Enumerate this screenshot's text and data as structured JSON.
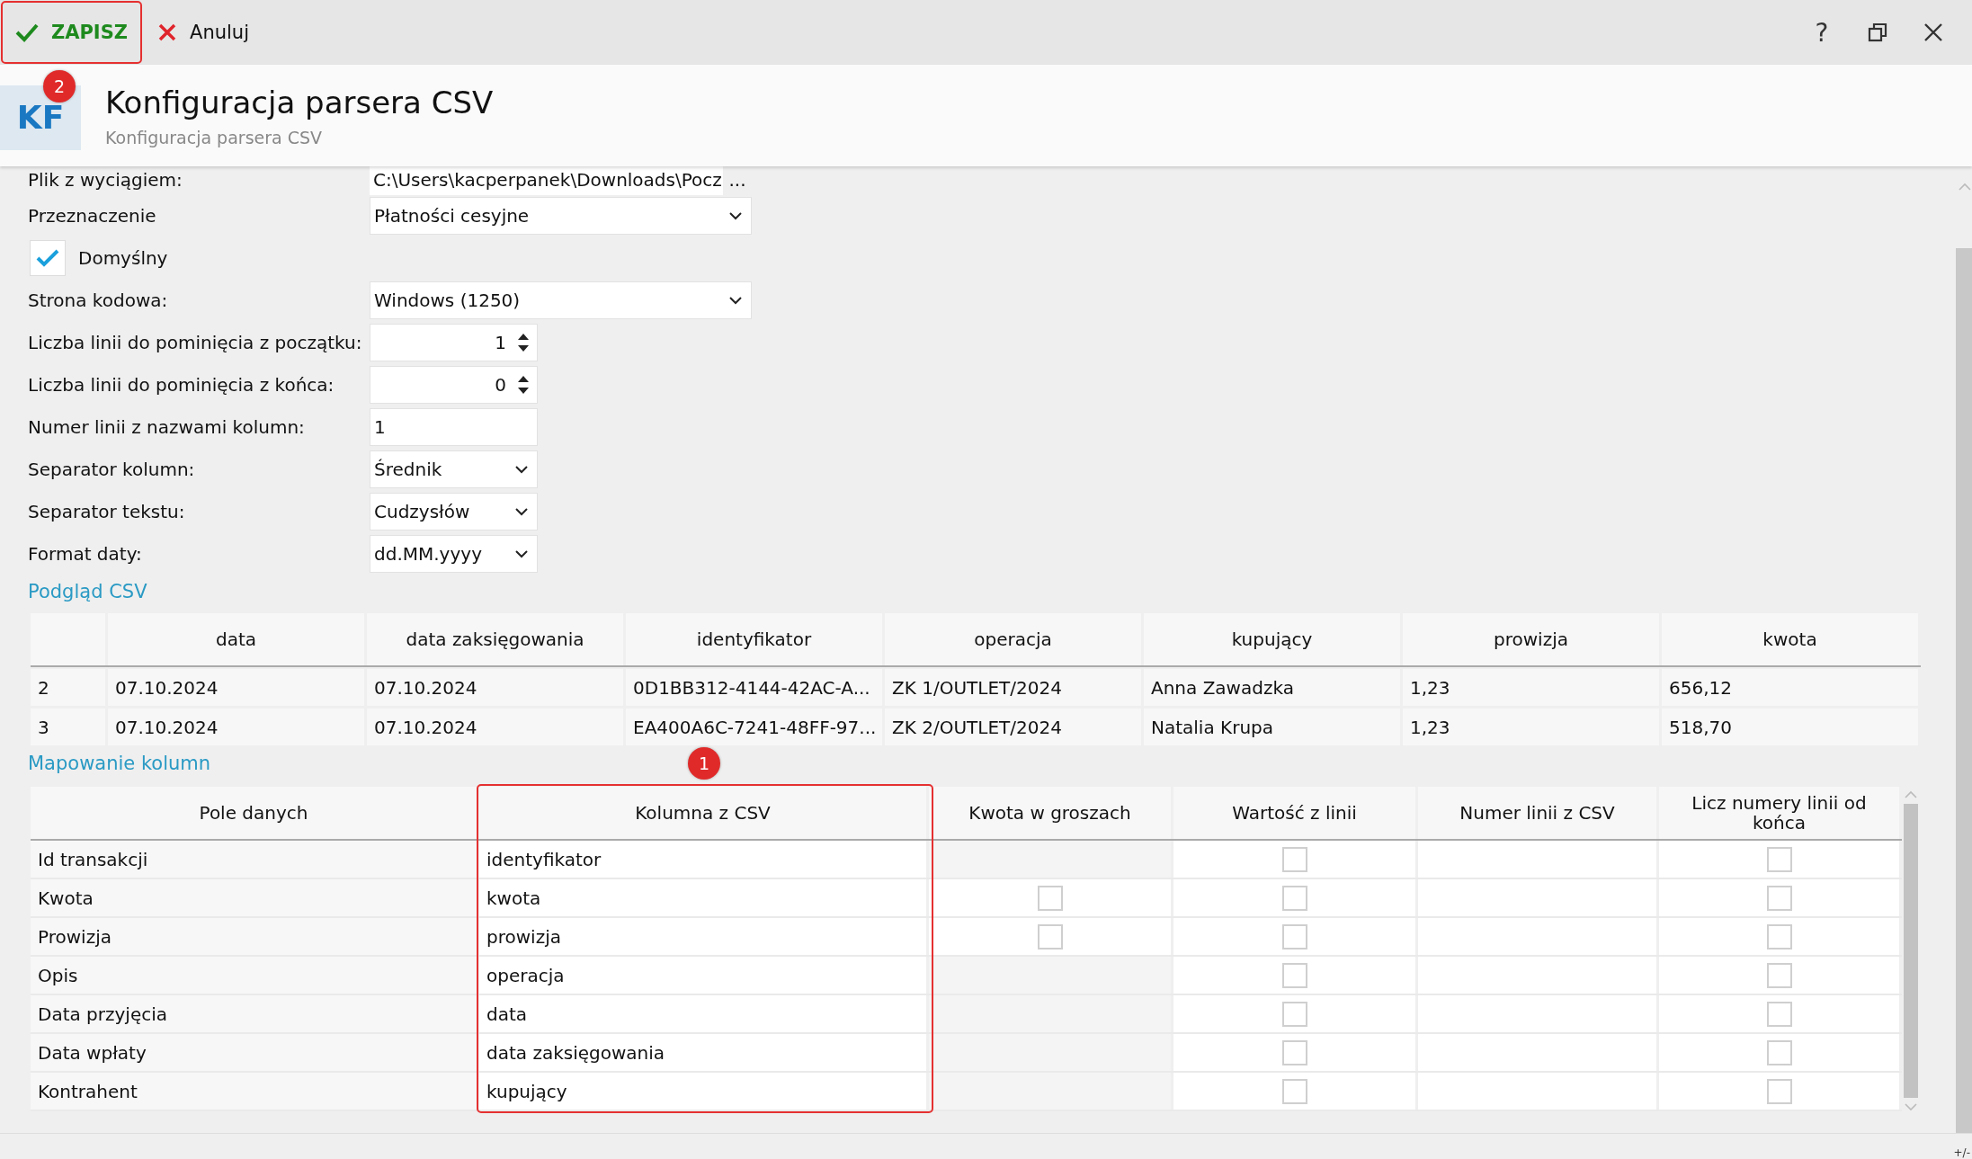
{
  "toolbar": {
    "buttons": [
      {
        "kind": "save",
        "label": "ZAPISZ",
        "highlighted": true
      },
      {
        "kind": "cancel",
        "label": "Anuluj",
        "highlighted": false
      }
    ],
    "window_controls": [
      {
        "kind": "help",
        "label": "?"
      },
      {
        "kind": "restore"
      },
      {
        "kind": "close"
      }
    ]
  },
  "header": {
    "logo": "KF",
    "badge": "2",
    "title": "Konfiguracja parsera CSV",
    "subtitle": "Konfiguracja parsera CSV"
  },
  "form": [
    {
      "kind": "file",
      "label": "Plik z wyciągiem:",
      "value": "C:\\Users\\kacperpanek\\Downloads\\Pocz",
      "button": "..."
    },
    {
      "kind": "dropdown",
      "label": "Przeznaczenie",
      "value": "Płatności cesyjne",
      "wide": true
    },
    {
      "kind": "checkbox",
      "label": "Domyślny",
      "checked": true
    },
    {
      "kind": "dropdown",
      "label": "Strona kodowa:",
      "value": "Windows (1250)",
      "wide": true
    },
    {
      "kind": "spinner",
      "label": "Liczba linii do pominięcia z początku:",
      "value": "1"
    },
    {
      "kind": "spinner",
      "label": "Liczba linii do pominięcia z końca:",
      "value": "0"
    },
    {
      "kind": "input",
      "label": "Numer linii z nazwami kolumn:",
      "value": "1"
    },
    {
      "kind": "dropdown",
      "label": "Separator kolumn:",
      "value": "Średnik",
      "wide": false
    },
    {
      "kind": "dropdown",
      "label": "Separator tekstu:",
      "value": "Cudzysłów",
      "wide": false
    },
    {
      "kind": "dropdown",
      "label": "Format daty:",
      "value": "dd.MM.yyyy",
      "wide": false
    }
  ],
  "preview": {
    "title": "Podgląd CSV",
    "columns": [
      "data",
      "data zaksięgowania",
      "identyfikator",
      "operacja",
      "kupujący",
      "prowizja",
      "kwota"
    ],
    "rows": [
      {
        "number": "2",
        "cells": [
          "07.10.2024",
          "07.10.2024",
          "0D1BB312-4144-42AC-A...",
          "ZK 1/OUTLET/2024",
          "Anna Zawadzka",
          "1,23",
          "656,12"
        ]
      },
      {
        "number": "3",
        "cells": [
          "07.10.2024",
          "07.10.2024",
          "EA400A6C-7241-48FF-97...",
          "ZK 2/OUTLET/2024",
          "Natalia Krupa",
          "1,23",
          "518,70"
        ]
      }
    ]
  },
  "mapping": {
    "title": "Mapowanie kolumn",
    "badge": "1",
    "columns": [
      {
        "label": "Pole danych",
        "highlighted": false
      },
      {
        "label": "Kolumna z CSV",
        "highlighted": true
      },
      {
        "label": "Kwota w groszach",
        "highlighted": false
      },
      {
        "label": "Wartość z linii",
        "highlighted": false
      },
      {
        "label": "Numer linii z CSV",
        "highlighted": false
      },
      {
        "label": "Licz numery linii od końca",
        "highlighted": false
      }
    ],
    "rows": [
      {
        "field": "Id transakcji",
        "csv_column": "identyfikator",
        "from_line_checked": false,
        "from_end_checked": false
      },
      {
        "field": "Kwota",
        "csv_column": "kwota",
        "grosze_checked": false,
        "from_line_checked": false,
        "from_end_checked": false
      },
      {
        "field": "Prowizja",
        "csv_column": "prowizja",
        "grosze_checked": false,
        "from_line_checked": false,
        "from_end_checked": false
      },
      {
        "field": "Opis",
        "csv_column": "operacja",
        "from_line_checked": false,
        "from_end_checked": false
      },
      {
        "field": "Data przyjęcia",
        "csv_column": "data",
        "from_line_checked": false,
        "from_end_checked": false
      },
      {
        "field": "Data wpłaty",
        "csv_column": "data zaksięgowania",
        "from_line_checked": false,
        "from_end_checked": false
      },
      {
        "field": "Kontrahent",
        "csv_column": "kupujący",
        "from_line_checked": false,
        "from_end_checked": false
      }
    ]
  },
  "status_bar": {
    "resize_label": "+/-"
  }
}
